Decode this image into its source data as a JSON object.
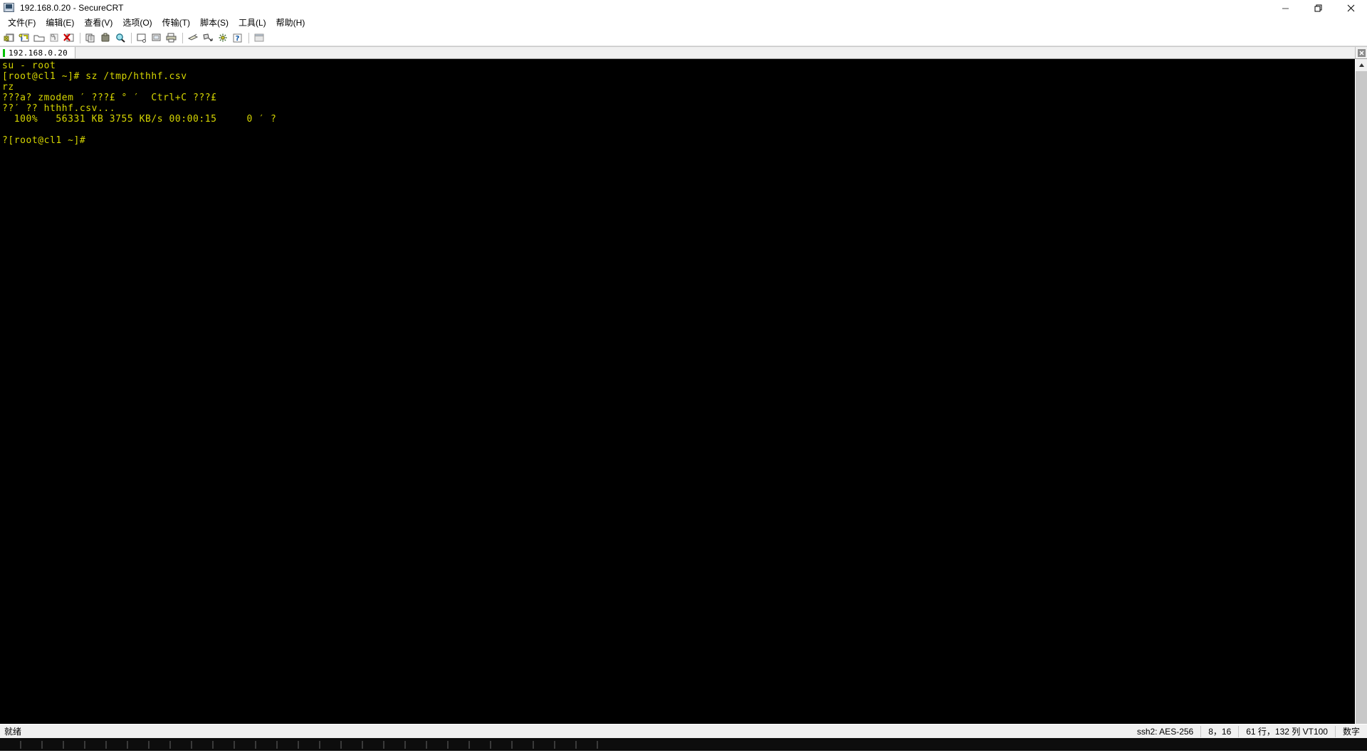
{
  "window": {
    "title": "192.168.0.20 - SecureCRT",
    "icon": "securecrt-app-icon",
    "minimize": "—",
    "maximize": "❐",
    "close": "✕"
  },
  "menubar": {
    "items": [
      {
        "label": "文件(F)",
        "name": "menu-file"
      },
      {
        "label": "编辑(E)",
        "name": "menu-edit"
      },
      {
        "label": "查看(V)",
        "name": "menu-view"
      },
      {
        "label": "选项(O)",
        "name": "menu-options"
      },
      {
        "label": "传输(T)",
        "name": "menu-transfer"
      },
      {
        "label": "脚本(S)",
        "name": "menu-script"
      },
      {
        "label": "工具(L)",
        "name": "menu-tools"
      },
      {
        "label": "帮助(H)",
        "name": "menu-help"
      }
    ]
  },
  "toolbar": {
    "buttons": [
      {
        "name": "new-session-icon",
        "tip": "新建会话"
      },
      {
        "name": "connect-icon",
        "tip": "连接"
      },
      {
        "name": "open-folder-icon",
        "tip": "打开"
      },
      {
        "name": "quick-connect-icon",
        "tip": "快速连接"
      },
      {
        "name": "disconnect-icon",
        "tip": "断开连接"
      },
      {
        "name": "copy-icon",
        "tip": "复制"
      },
      {
        "name": "paste-icon",
        "tip": "粘贴"
      },
      {
        "name": "find-icon",
        "tip": "查找"
      },
      {
        "name": "log-session-icon",
        "tip": "记录会话"
      },
      {
        "name": "print-screen-icon",
        "tip": "打印屏幕"
      },
      {
        "name": "print-icon",
        "tip": "打印"
      },
      {
        "name": "transfer-receive-icon",
        "tip": "接收"
      },
      {
        "name": "transfer-send-icon",
        "tip": "发送"
      },
      {
        "name": "properties-icon",
        "tip": "属性"
      },
      {
        "name": "help-icon",
        "tip": "帮助"
      },
      {
        "name": "terminal-window-icon",
        "tip": "终端"
      }
    ]
  },
  "tabbar": {
    "tabs": [
      {
        "label": "192.168.0.20",
        "name": "session-tab",
        "status_color": "#00c000",
        "active": true
      }
    ],
    "close_button": "✕"
  },
  "terminal": {
    "foreground": "#d6d600",
    "background": "#000000",
    "lines": [
      "su - root",
      "[root@cl1 ~]# sz /tmp/hthhf.csv",
      "rz",
      "???a? zmodem ′ ???£ ° ′  Ctrl+C ???£",
      "??′ ?? hthhf.csv...",
      "  100%   56331 KB 3755 KB/s 00:00:15     0 ′ ?",
      "",
      "?[root@cl1 ~]#"
    ]
  },
  "scrollbar": {
    "up_arrow": "▲",
    "down_arrow": "▼"
  },
  "statusbar": {
    "ready": "就绪",
    "cells": [
      {
        "name": "status-protocol",
        "text": "ssh2: AES-256"
      },
      {
        "name": "status-cursor-position",
        "text": "8，16"
      },
      {
        "name": "status-screen-size",
        "text": "61 行，132 列  VT100"
      },
      {
        "name": "status-keypad-mode",
        "text": "数字"
      }
    ]
  }
}
